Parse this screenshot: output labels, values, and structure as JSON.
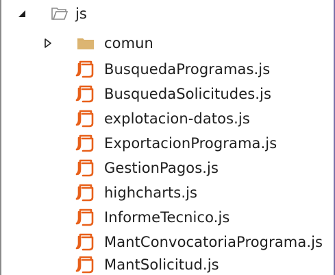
{
  "accent_colors": {
    "js_file_icon": "#e8601a",
    "folder_fill": "#d9b06a",
    "open_folder_outline": "#8a8a8a",
    "expander": "#1e1e1e"
  },
  "tree": {
    "root": {
      "label": "js",
      "icon": "folder-open-icon",
      "expander": "expanded"
    },
    "subfolder": {
      "label": "comun",
      "icon": "folder-icon",
      "expander": "collapsed"
    },
    "files": [
      {
        "label": "BusquedaProgramas.js",
        "icon": "js-file-icon"
      },
      {
        "label": "BusquedaSolicitudes.js",
        "icon": "js-file-icon"
      },
      {
        "label": "explotacion-datos.js",
        "icon": "js-file-icon"
      },
      {
        "label": "ExportacionPrograma.js",
        "icon": "js-file-icon"
      },
      {
        "label": "GestionPagos.js",
        "icon": "js-file-icon"
      },
      {
        "label": "highcharts.js",
        "icon": "js-file-icon"
      },
      {
        "label": "InformeTecnico.js",
        "icon": "js-file-icon"
      },
      {
        "label": "MantConvocatoriaPrograma.js",
        "icon": "js-file-icon"
      },
      {
        "label": "MantSolicitud.js",
        "icon": "js-file-icon"
      }
    ]
  }
}
